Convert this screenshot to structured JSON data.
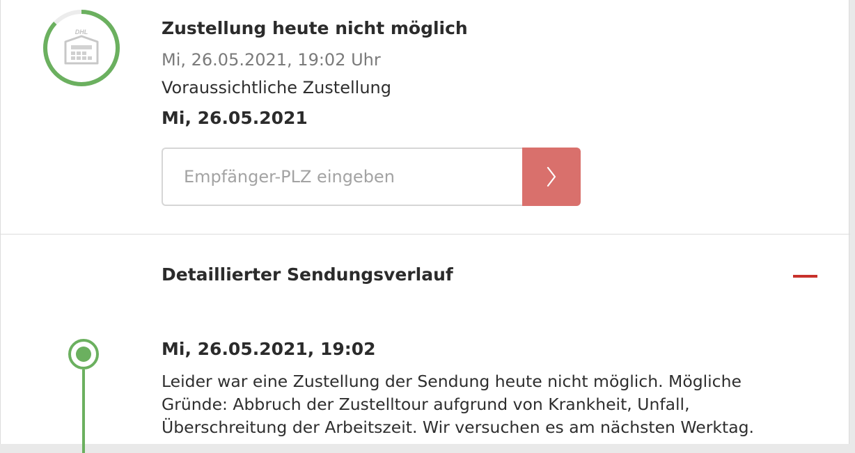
{
  "status": {
    "icon": "dhl-depot-icon",
    "title": "Zustellung heute nicht möglich",
    "datetime": "Mi, 26.05.2021, 19:02 Uhr",
    "progress_percent": 87,
    "ring_color": "#6bb05f"
  },
  "expected": {
    "label": "Voraussichtliche Zustellung",
    "date": "Mi, 26.05.2021"
  },
  "plz_form": {
    "placeholder": "Empfänger-PLZ eingeben",
    "value": "",
    "submit_icon": "chevron-right-icon",
    "button_color": "#d9706c"
  },
  "history": {
    "heading": "Detaillierter Sendungsverlauf",
    "toggle_icon": "minus-icon",
    "accent_color": "#c8312b",
    "events": [
      {
        "date": "Mi, 26.05.2021, 19:02",
        "text": "Leider war eine Zustellung der Sendung heute nicht möglich. Mögliche Gründe: Abbruch der Zustelltour aufgrund von Krankheit, Unfall, Überschreitung der Arbeitszeit. Wir versuchen es am nächsten Werktag."
      }
    ]
  }
}
